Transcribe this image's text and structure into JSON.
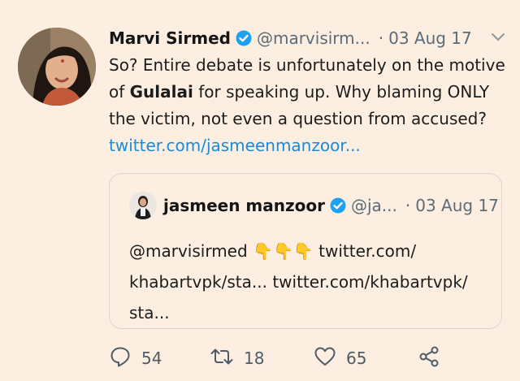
{
  "tweet": {
    "author_name": "Marvi Sirmed",
    "handle": "@marvisirm...",
    "separator": "·",
    "date": "03 Aug 17",
    "text_part1": "So? Entire debate is unfortunately on the motive of ",
    "text_bold": "Gulalai",
    "text_part2": " for speaking up. Why blaming ONLY the victim, not even a question from accused?",
    "link": "twitter.com/jasmeenmanzoor..."
  },
  "quoted_tweet": {
    "author_name": "jasmeen manzoor",
    "handle": "@ja...",
    "separator": "·",
    "date": "03 Aug 17",
    "mention": "@marvisirmed",
    "emojis": "👇👇👇",
    "text_rest": " twitter.com/ khabartvpk/sta... twitter.com/khabartvpk/ sta..."
  },
  "actions": {
    "replies": "54",
    "retweets": "18",
    "likes": "65"
  },
  "colors": {
    "background": "#fcefe1",
    "link": "#1b8ad6",
    "verified": "#1da1f2",
    "muted": "#5b6b78"
  },
  "icons": [
    "verified-badge-icon",
    "chevron-down-icon",
    "reply-icon",
    "retweet-icon",
    "heart-icon",
    "share-icon"
  ]
}
